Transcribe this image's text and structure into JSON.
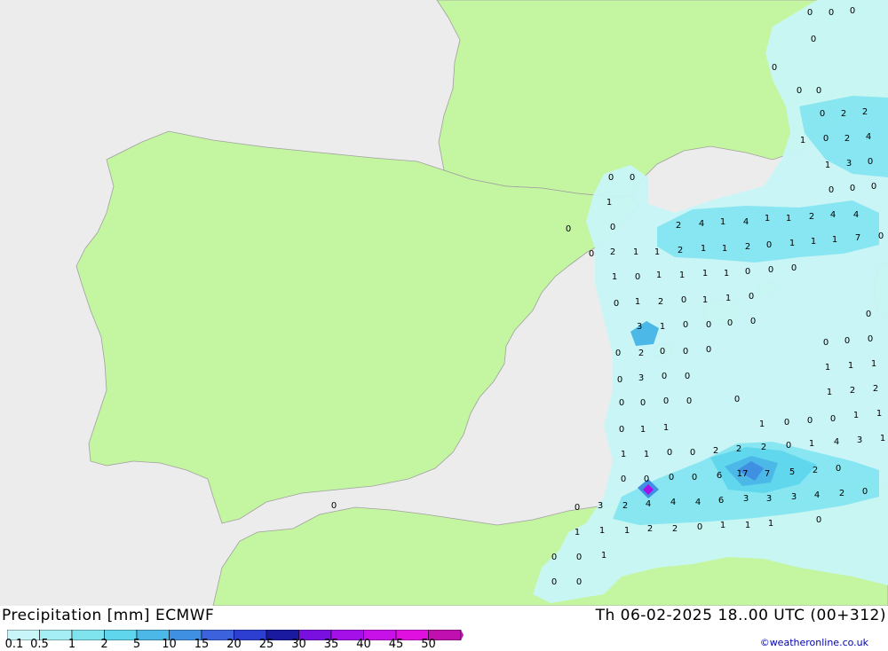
{
  "header": {
    "title": "Precipitation [mm] ECMWF",
    "valid_time": "Th 06-02-2025 18..00 UTC (00+312)"
  },
  "credit": "©weatheronline.co.uk",
  "legend": {
    "labels": [
      "0.1",
      "0.5",
      "1",
      "2",
      "5",
      "10",
      "15",
      "20",
      "25",
      "30",
      "35",
      "40",
      "45",
      "50"
    ],
    "colors": [
      "#c8f5f8",
      "#a5eef5",
      "#80e4ef",
      "#5fd6ec",
      "#4bb8e8",
      "#3f8fe3",
      "#3c62dd",
      "#2d3fd0",
      "#1a1aa0",
      "#7a10e0",
      "#a510e8",
      "#c810e8",
      "#e010e0",
      "#c010b0"
    ]
  },
  "map": {
    "land_color": "#c4f5a0",
    "sea_color": "#ececec",
    "values": [
      [
        "0",
        912,
        14
      ],
      [
        "0",
        936,
        14
      ],
      [
        "0",
        960,
        12
      ],
      [
        "0",
        916,
        44
      ],
      [
        "0",
        872,
        76
      ],
      [
        "0",
        900,
        102
      ],
      [
        "0",
        922,
        102
      ],
      [
        "0",
        926,
        128
      ],
      [
        "2",
        950,
        128
      ],
      [
        "2",
        974,
        126
      ],
      [
        "1",
        904,
        158
      ],
      [
        "0",
        930,
        156
      ],
      [
        "2",
        954,
        156
      ],
      [
        "4",
        978,
        154
      ],
      [
        "1",
        932,
        186
      ],
      [
        "3",
        956,
        184
      ],
      [
        "0",
        980,
        182
      ],
      [
        "0",
        688,
        200
      ],
      [
        "0",
        712,
        200
      ],
      [
        "0",
        936,
        214
      ],
      [
        "0",
        960,
        212
      ],
      [
        "0",
        984,
        210
      ],
      [
        "1",
        686,
        228
      ],
      [
        "0",
        640,
        258
      ],
      [
        "0",
        690,
        256
      ],
      [
        "2",
        764,
        254
      ],
      [
        "4",
        790,
        252
      ],
      [
        "1",
        814,
        250
      ],
      [
        "4",
        840,
        250
      ],
      [
        "1",
        864,
        246
      ],
      [
        "1",
        888,
        246
      ],
      [
        "2",
        914,
        244
      ],
      [
        "4",
        938,
        242
      ],
      [
        "4",
        964,
        242
      ],
      [
        "0",
        666,
        286
      ],
      [
        "2",
        690,
        284
      ],
      [
        "1",
        716,
        284
      ],
      [
        "1",
        740,
        284
      ],
      [
        "2",
        766,
        282
      ],
      [
        "1",
        792,
        280
      ],
      [
        "1",
        816,
        280
      ],
      [
        "2",
        842,
        278
      ],
      [
        "0",
        866,
        276
      ],
      [
        "1",
        892,
        274
      ],
      [
        "1",
        916,
        272
      ],
      [
        "1",
        940,
        270
      ],
      [
        "7",
        966,
        268
      ],
      [
        "0",
        992,
        266
      ],
      [
        "1",
        692,
        312
      ],
      [
        "0",
        718,
        312
      ],
      [
        "1",
        742,
        310
      ],
      [
        "1",
        768,
        310
      ],
      [
        "1",
        794,
        308
      ],
      [
        "1",
        818,
        308
      ],
      [
        "0",
        842,
        306
      ],
      [
        "0",
        868,
        304
      ],
      [
        "0",
        894,
        302
      ],
      [
        "0",
        694,
        342
      ],
      [
        "1",
        718,
        340
      ],
      [
        "2",
        744,
        340
      ],
      [
        "0",
        770,
        338
      ],
      [
        "1",
        794,
        338
      ],
      [
        "1",
        820,
        336
      ],
      [
        "0",
        846,
        334
      ],
      [
        "3",
        720,
        368
      ],
      [
        "1",
        746,
        368
      ],
      [
        "0",
        772,
        366
      ],
      [
        "0",
        798,
        366
      ],
      [
        "0",
        822,
        364
      ],
      [
        "0",
        848,
        362
      ],
      [
        "0",
        978,
        354
      ],
      [
        "0",
        696,
        398
      ],
      [
        "2",
        722,
        398
      ],
      [
        "0",
        746,
        396
      ],
      [
        "0",
        772,
        396
      ],
      [
        "0",
        798,
        394
      ],
      [
        "0",
        930,
        386
      ],
      [
        "0",
        954,
        384
      ],
      [
        "0",
        980,
        382
      ],
      [
        "0",
        698,
        428
      ],
      [
        "3",
        722,
        426
      ],
      [
        "0",
        748,
        424
      ],
      [
        "0",
        774,
        424
      ],
      [
        "1",
        932,
        414
      ],
      [
        "1",
        958,
        412
      ],
      [
        "1",
        984,
        410
      ],
      [
        "0",
        700,
        454
      ],
      [
        "0",
        724,
        454
      ],
      [
        "0",
        750,
        452
      ],
      [
        "0",
        776,
        452
      ],
      [
        "0",
        830,
        450
      ],
      [
        "1",
        934,
        442
      ],
      [
        "2",
        960,
        440
      ],
      [
        "2",
        986,
        438
      ],
      [
        "0",
        700,
        484
      ],
      [
        "1",
        724,
        484
      ],
      [
        "1",
        750,
        482
      ],
      [
        "1",
        858,
        478
      ],
      [
        "0",
        886,
        476
      ],
      [
        "0",
        912,
        474
      ],
      [
        "0",
        938,
        472
      ],
      [
        "1",
        964,
        468
      ],
      [
        "1",
        990,
        466
      ],
      [
        "1",
        702,
        512
      ],
      [
        "1",
        728,
        512
      ],
      [
        "0",
        754,
        510
      ],
      [
        "0",
        780,
        510
      ],
      [
        "2",
        806,
        508
      ],
      [
        "2",
        832,
        506
      ],
      [
        "2",
        860,
        504
      ],
      [
        "0",
        888,
        502
      ],
      [
        "1",
        914,
        500
      ],
      [
        "4",
        942,
        498
      ],
      [
        "3",
        968,
        496
      ],
      [
        "1",
        994,
        494
      ],
      [
        "0",
        702,
        540
      ],
      [
        "0",
        728,
        540
      ],
      [
        "0",
        756,
        538
      ],
      [
        "0",
        782,
        538
      ],
      [
        "6",
        810,
        536
      ],
      [
        "17",
        836,
        534
      ],
      [
        "7",
        864,
        534
      ],
      [
        "5",
        892,
        532
      ],
      [
        "2",
        918,
        530
      ],
      [
        "0",
        944,
        528
      ],
      [
        "0",
        650,
        572
      ],
      [
        "3",
        676,
        570
      ],
      [
        "2",
        704,
        570
      ],
      [
        "4",
        730,
        568
      ],
      [
        "4",
        758,
        566
      ],
      [
        "4",
        786,
        566
      ],
      [
        "6",
        812,
        564
      ],
      [
        "3",
        840,
        562
      ],
      [
        "3",
        866,
        562
      ],
      [
        "3",
        894,
        560
      ],
      [
        "4",
        920,
        558
      ],
      [
        "2",
        948,
        556
      ],
      [
        "0",
        974,
        554
      ],
      [
        "0",
        376,
        570
      ],
      [
        "1",
        650,
        600
      ],
      [
        "1",
        678,
        598
      ],
      [
        "1",
        706,
        598
      ],
      [
        "2",
        732,
        596
      ],
      [
        "2",
        760,
        596
      ],
      [
        "0",
        788,
        594
      ],
      [
        "1",
        814,
        592
      ],
      [
        "1",
        842,
        592
      ],
      [
        "1",
        868,
        590
      ],
      [
        "0",
        922,
        586
      ],
      [
        "0",
        624,
        628
      ],
      [
        "0",
        652,
        628
      ],
      [
        "1",
        680,
        626
      ],
      [
        "0",
        624,
        656
      ],
      [
        "0",
        652,
        656
      ]
    ]
  }
}
